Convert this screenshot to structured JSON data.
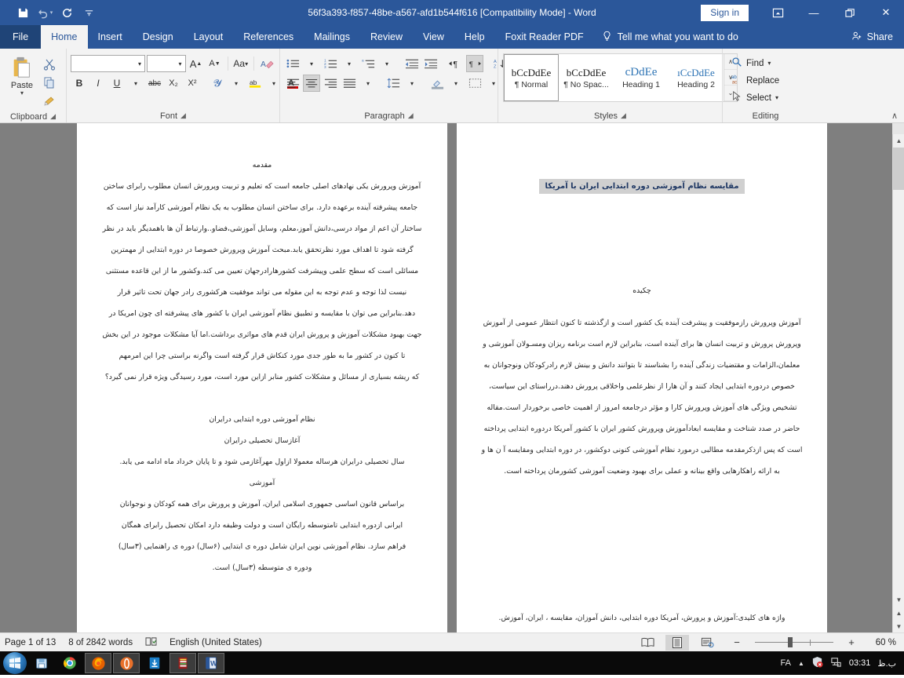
{
  "window": {
    "title": "56f3a393-f857-48be-a567-afd1b544f616 [Compatibility Mode]  -  Word",
    "signin_label": "Sign in",
    "quick_access": [
      {
        "name": "save-icon",
        "glyph": "💾"
      },
      {
        "name": "undo-icon",
        "glyph": "↶"
      },
      {
        "name": "redo-icon",
        "glyph": "↻"
      },
      {
        "name": "customize-qat-icon",
        "glyph": "⌄"
      }
    ],
    "controls": {
      "ribbon_display": "⬒",
      "minimize": "—",
      "restore": "❐",
      "close": "✕"
    }
  },
  "ribbon": {
    "tabs": [
      {
        "label": "File",
        "active": false
      },
      {
        "label": "Home",
        "active": true
      },
      {
        "label": "Insert",
        "active": false
      },
      {
        "label": "Design",
        "active": false
      },
      {
        "label": "Layout",
        "active": false
      },
      {
        "label": "References",
        "active": false
      },
      {
        "label": "Mailings",
        "active": false
      },
      {
        "label": "Review",
        "active": false
      },
      {
        "label": "View",
        "active": false
      },
      {
        "label": "Help",
        "active": false
      },
      {
        "label": "Foxit Reader PDF",
        "active": false
      }
    ],
    "tell_me": "Tell me what you want to do",
    "share": "Share",
    "groups": {
      "clipboard": {
        "label": "Clipboard",
        "paste": "Paste",
        "cut_icon": "✂",
        "copy_icon": "⧉",
        "format_painter_icon": "🖌"
      },
      "font": {
        "label": "Font",
        "font_name_value": "",
        "font_size_value": "",
        "grow_font": "A",
        "shrink_font": "A",
        "change_case": "Aa",
        "clear_formatting": "A",
        "bold": "B",
        "italic": "I",
        "underline": "U",
        "strikethrough": "abc",
        "subscript": "X₂",
        "superscript": "X²",
        "text_effects": "A",
        "highlight": "ab",
        "font_color": "A"
      },
      "paragraph": {
        "label": "Paragraph",
        "bullets": "≣",
        "numbering": "≣",
        "multilevel": "≣",
        "decrease_indent": "⇤",
        "increase_indent": "⇥",
        "ltr_text_direction": "¶",
        "rtl_text_direction": "¶",
        "sort": "A↓",
        "show_marks": "¶",
        "align_left": "≡",
        "align_center": "≡",
        "align_right": "≡",
        "justify": "≡",
        "line_spacing": "↕",
        "shading": "▤",
        "borders": "▦"
      },
      "styles": {
        "label": "Styles",
        "items": [
          {
            "preview": "bCcDdEe",
            "name": "¶ Normal",
            "selected": true,
            "kind": "normal"
          },
          {
            "preview": "bCcDdEe",
            "name": "¶ No Spac...",
            "selected": false,
            "kind": "normal"
          },
          {
            "preview": "cDdEe",
            "name": "Heading 1",
            "selected": false,
            "kind": "h1"
          },
          {
            "preview": "ıCcDdEe",
            "name": "Heading 2",
            "selected": false,
            "kind": "h2"
          }
        ],
        "scroll_up": "∧",
        "scroll_down": "∨",
        "more": "⌄"
      },
      "editing": {
        "label": "Editing",
        "find": "Find",
        "replace": "Replace",
        "select": "Select"
      }
    },
    "collapse_icon": "∧"
  },
  "document": {
    "right_page": {
      "title": "مقایسه نظام آموزشی دوره ابتدایی ایران با آمریکا",
      "abstract_heading": "چکیده",
      "abstract_lines": [
        "آموزش وپرورش رازموفقیت و پیشرفت آینده یک کشور است و ازگذشته تا کنون انتظار عمومی از آموزش",
        "وپرورش پرورش و تربیت انسان ها برای آینده است، بنابراین لازم است برنامه ریزان ومسـولان آموزشی و",
        "معلمان،الزامات و مقتضیات زندگی آینده را بشناسند تا بتوانند دانش و بینش لازم رادرکودکان ونوجوانان به",
        "خصوص دردوره ابتدایی ایجاد کنند و آن هارا از نظرعلمی واخلاقی پرورش دهند.درراستای این سیاست،",
        "تشخیص ویژگی های آموزش وپرورش کارا و مؤثر درجامعه امروز از اهمیت خاصی برخوردار است.مقاله",
        "حاضر در صدد شناخت و مقایسه ابعادآموزش وپرورش کشور ایران با کشور آمریکا دردوره ابتدایی پرداخته",
        "است که پس ازذکرمقدمه مطالبی درمورد نظام آموزشی کنونی دوکشور، در دوره ابتدایی ومقایسه آ ن ها و",
        "به ارائه راهکارهایی واقع بینانه و عملی برای بهبود وضعیت آموزشی کشورمان پرداخته است."
      ],
      "keywords_line": "واژه های کلیدی:آموزش و پرورش، آمریکا دوره ابتدایی، دانش آموزان، مقایسه ، ایران، آموزش."
    },
    "left_page": {
      "intro_heading": "مقدمه",
      "intro_lines": [
        "آموزش وپرورش یکی نهادهای اصلی جامعه است که تعلیم و تربیت وپرورش انسان مطلوب رابرای ساختن",
        "جامعه پیشرفته آینده برعهده دارد. برای ساختن انسان مطلوب به یک نظام آموزشی کارآمد نیاز است که",
        "ساختار آن اعم از مواد درسی،دانش آموز،معلم، وسایل آموزشی،فضاو..وارتباط آن ها باهمدیگر باید  در نظر",
        "گرفته شود تا اهداف مورد نظرتحقق یابد.مبحث آموزش وپرورش خصوصا در دوره ابتدایی از مهمترین",
        "مسائلی است که سطح علمی وپیشرفت کشورهارادرجهان تعیین می کند.وکشور ما از این قاعده مستثنی",
        "نیست لذا توجه و عدم توجه به این مقوله می تواند موفقیت هرکشوری رادر جهان تحت تاثیر قرار",
        "دهد.بنابراین می توان با مقایسه و تطبیق نظام آموزشی ایران با کشور های پیشرفته ای چون  امریکا در",
        "جهت بهبود مشکلات  آموزش و پرورش ایران قدم های مواثری برداشت.اما آیا مشکلات موجود در این بخش",
        "تا کنون در کشور ما به طور جدی مورد کنکاش قرار گرفته است واگرنه براستی چرا این امرمهم",
        "که ریشه بسیاری از مسائل و مشکلات کشور منابر ازاین مورد است، مورد رسیدگی ویژه قرار نمی گیرد؟"
      ],
      "section_heading_1": "نظام آموزشی دوره ابتدایی درایران",
      "section_heading_2": "آغازسال تحصیلی درایران",
      "line_after_h2": "سال تحصیلی درایران هرساله معمولا ازاول مهرآغازمی شود و تا پایان خرداد ماه ادامه می یابد.",
      "section_heading_3": "آموزشی",
      "body_lines_2": [
        "براساس قانون اساسی جمهوری اسلامی ایران، آموزش و پرورش برای همه کودکان و نوجوانان",
        "ایرانی ازدوره ابتدایی تامتوسطه رایگان است و دولت وظیفه دارد امکان تحصیل رابرای همگان",
        "فراهم سازد. نظام آموزشی نوین ایران شامل دوره ی ابتدایی (۶سال) دوره ی راهنمایی (۳سال)",
        "ودوره ی متوسطه (۳سال) است."
      ]
    }
  },
  "status_bar": {
    "page": "Page 1 of 13",
    "words": "8 of 2842 words",
    "proofing_icon": "📖",
    "language": "English (United States)",
    "views": [
      {
        "name": "read-mode",
        "glyph": "📖",
        "active": false
      },
      {
        "name": "print-layout",
        "glyph": "☰",
        "active": true
      },
      {
        "name": "web-layout",
        "glyph": "☷",
        "active": false
      }
    ],
    "zoom_out": "−",
    "zoom_in": "+",
    "zoom_level": "60 %"
  },
  "taskbar": {
    "start": "⊞",
    "items": [
      {
        "name": "taskbar-explorer",
        "glyph": "📁",
        "color": "#e8c35a",
        "active": false
      },
      {
        "name": "taskbar-chrome",
        "glyph": "◎",
        "color": "#4caf50",
        "active": false
      },
      {
        "name": "taskbar-firefox",
        "glyph": "🔥",
        "color": "#e66000",
        "active": true
      },
      {
        "name": "taskbar-opera",
        "glyph": "●",
        "color": "#cc0f16",
        "active": true
      },
      {
        "name": "taskbar-foxit",
        "glyph": "↓",
        "color": "#1a7ec8",
        "active": false
      },
      {
        "name": "taskbar-dictionary",
        "glyph": "≣",
        "color": "#9b1b1b",
        "active": true
      },
      {
        "name": "taskbar-word",
        "glyph": "W",
        "color": "#2b579a",
        "active": true
      }
    ],
    "tray": {
      "language": "FA",
      "show_hidden": "▲",
      "security_icon": "🛡",
      "network_icon": "🖧",
      "clock": "03:31",
      "meridiem": "ب.ظ"
    }
  }
}
